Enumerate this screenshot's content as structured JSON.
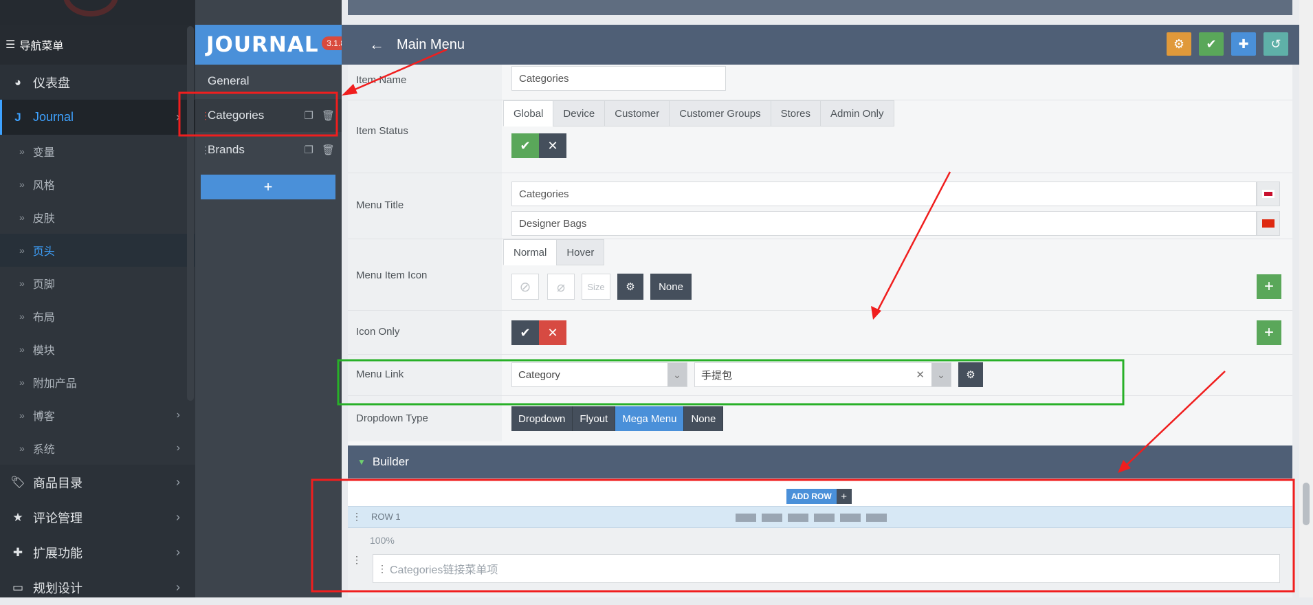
{
  "sidebar": {
    "nav_header": "导航菜单",
    "items": [
      {
        "label": "仪表盘",
        "icon": "dashboard-icon"
      },
      {
        "label": "Journal",
        "icon": "journal-j-icon"
      },
      {
        "label": "商品目录",
        "icon": "tags-icon"
      },
      {
        "label": "评论管理",
        "icon": "star-icon"
      },
      {
        "label": "扩展功能",
        "icon": "puzzle-icon"
      },
      {
        "label": "规划设计",
        "icon": "monitor-icon"
      }
    ],
    "sub_items": [
      {
        "label": "变量"
      },
      {
        "label": "风格"
      },
      {
        "label": "皮肤"
      },
      {
        "label": "页头"
      },
      {
        "label": "页脚"
      },
      {
        "label": "布局"
      },
      {
        "label": "模块"
      },
      {
        "label": "附加产品"
      },
      {
        "label": "博客"
      },
      {
        "label": "系统"
      }
    ]
  },
  "journal": {
    "brand": "JOURNAL",
    "version": "3.1.8",
    "items": [
      {
        "label": "General"
      },
      {
        "label": "Categories"
      },
      {
        "label": "Brands"
      }
    ],
    "add_label": "+"
  },
  "header": {
    "title": "Main Menu",
    "accent": "#4a90d9"
  },
  "form": {
    "item_name": {
      "label": "Item Name",
      "value": "Categories"
    },
    "item_status": {
      "label": "Item Status",
      "tabs": [
        "Global",
        "Device",
        "Customer",
        "Customer Groups",
        "Stores",
        "Admin Only"
      ],
      "active_tab": "Global"
    },
    "menu_title": {
      "label": "Menu Title",
      "values": [
        "Categories",
        "Designer Bags"
      ]
    },
    "menu_item_icon": {
      "label": "Menu Item Icon",
      "tabs": [
        "Normal",
        "Hover"
      ],
      "size_placeholder": "Size",
      "none_label": "None"
    },
    "icon_only": {
      "label": "Icon Only"
    },
    "menu_link": {
      "label": "Menu Link",
      "type": "Category",
      "value": "手提包"
    },
    "dropdown_type": {
      "label": "Dropdown Type",
      "options": [
        "Dropdown",
        "Flyout",
        "Mega Menu",
        "None"
      ],
      "selected": "Mega Menu"
    }
  },
  "builder": {
    "title": "Builder",
    "add_row": "ADD ROW",
    "row_name": "ROW 1",
    "column_width": "100%",
    "column_item": "Categories链接菜单项"
  }
}
